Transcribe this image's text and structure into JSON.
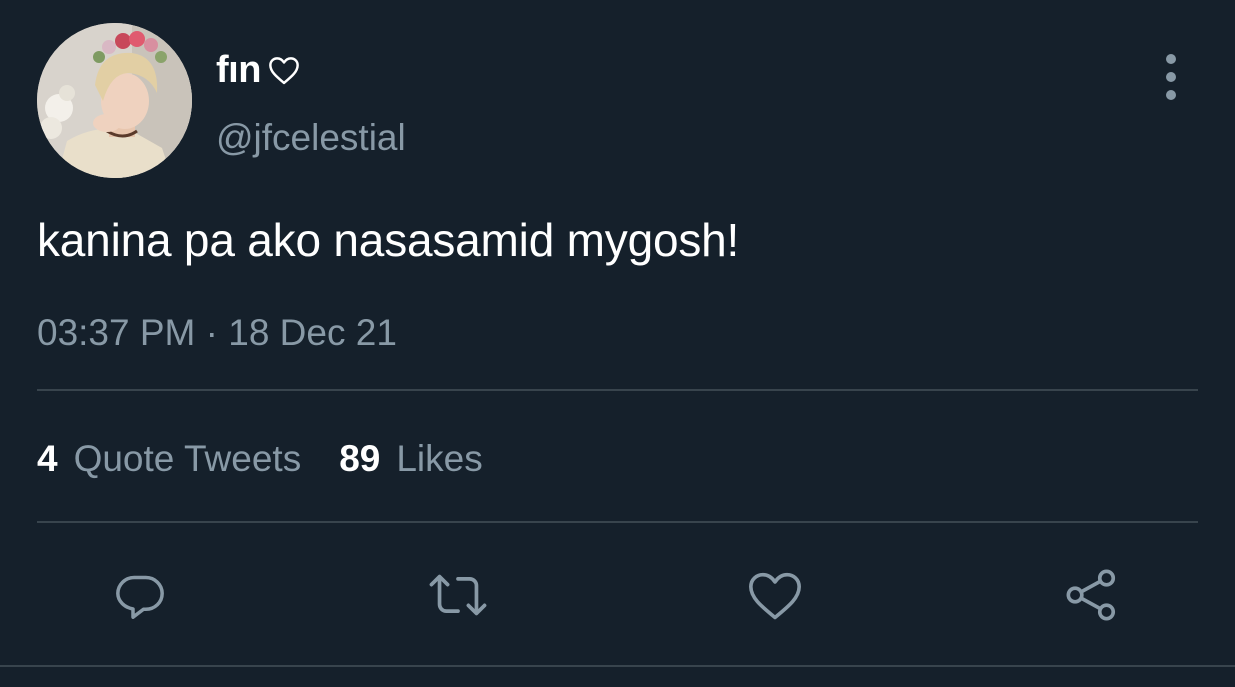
{
  "tweet": {
    "author": {
      "display_name": "fın",
      "name_icon": "heart-outline-icon",
      "handle": "@jfcelestial",
      "avatar": "profile-photo"
    },
    "text": "kanina pa ako nasasamid mygosh!",
    "timestamp": "03:37 PM · 18 Dec 21",
    "stats": {
      "quote_tweets": {
        "count": "4",
        "label": "Quote Tweets"
      },
      "likes": {
        "count": "89",
        "label": "Likes"
      }
    },
    "actions": [
      "reply-icon",
      "retweet-icon",
      "like-icon",
      "share-icon"
    ],
    "more_icon": "more-vertical-icon"
  },
  "colors": {
    "background": "#15202b",
    "primary_text": "#ffffff",
    "secondary_text": "#8899a6",
    "divider": "#38444d"
  }
}
